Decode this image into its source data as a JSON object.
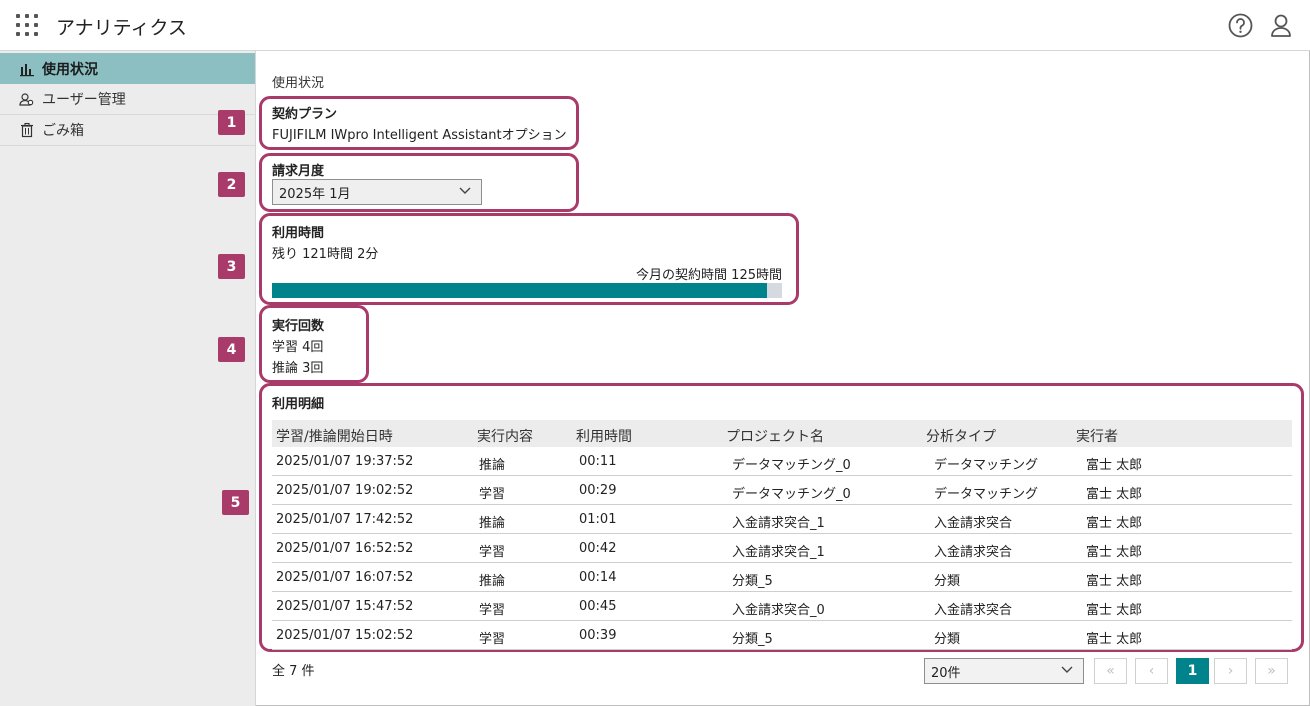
{
  "app": {
    "title": "アナリティクス"
  },
  "sidebar": {
    "items": [
      {
        "label": "使用状況",
        "icon": "bar-chart-icon"
      },
      {
        "label": "ユーザー管理",
        "icon": "users-icon"
      },
      {
        "label": "ごみ箱",
        "icon": "trash-icon"
      }
    ]
  },
  "main": {
    "breadcrumb": "使用状況",
    "badges": [
      "1",
      "2",
      "3",
      "4",
      "5"
    ],
    "plan": {
      "title": "契約プラン",
      "value": "FUJIFILM IWpro Intelligent Assistantオプション"
    },
    "billing": {
      "title": "請求月度",
      "selected": "2025年 1月"
    },
    "usage": {
      "title": "利用時間",
      "remaining": "残り 121時間 2分",
      "contract": "今月の契約時間 125時間",
      "progress_fraction": 0.97
    },
    "runs": {
      "title": "実行回数",
      "training": "学習 4回",
      "inference": "推論 3回"
    },
    "details": {
      "title": "利用明細",
      "columns": [
        "学習/推論開始日時",
        "実行内容",
        "利用時間",
        "プロジェクト名",
        "分析タイプ",
        "実行者"
      ],
      "rows": [
        [
          "2025/01/07 19:37:52",
          "推論",
          "00:11",
          "データマッチング_0",
          "データマッチング",
          "富士 太郎"
        ],
        [
          "2025/01/07 19:02:52",
          "学習",
          "00:29",
          "データマッチング_0",
          "データマッチング",
          "富士 太郎"
        ],
        [
          "2025/01/07 17:42:52",
          "推論",
          "01:01",
          "入金請求突合_1",
          "入金請求突合",
          "富士 太郎"
        ],
        [
          "2025/01/07 16:52:52",
          "学習",
          "00:42",
          "入金請求突合_1",
          "入金請求突合",
          "富士 太郎"
        ],
        [
          "2025/01/07 16:07:52",
          "推論",
          "00:14",
          "分類_5",
          "分類",
          "富士 太郎"
        ],
        [
          "2025/01/07 15:47:52",
          "学習",
          "00:45",
          "入金請求突合_0",
          "入金請求突合",
          "富士 太郎"
        ],
        [
          "2025/01/07 15:02:52",
          "学習",
          "00:39",
          "分類_5",
          "分類",
          "富士 太郎"
        ]
      ],
      "total": "全 7 件",
      "page_size": "20件",
      "pager": {
        "first": "«",
        "prev": "‹",
        "current": "1",
        "next": "›",
        "last": "»"
      }
    }
  },
  "colors": {
    "accent": "#00838a",
    "annotation": "#a93b6a",
    "sidebar_active": "#8bbfc2"
  }
}
